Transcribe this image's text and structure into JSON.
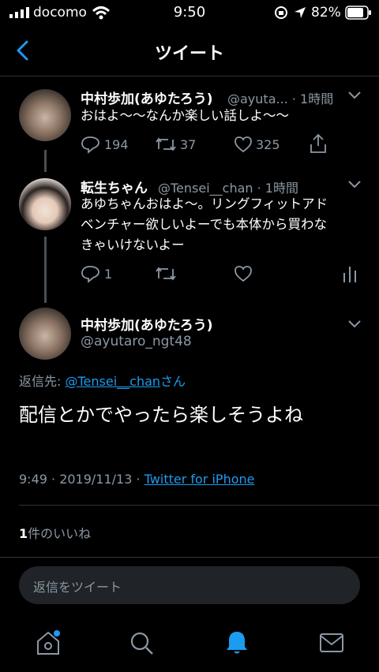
{
  "status": {
    "carrier": "docomo",
    "time": "9:50",
    "battery": "82%"
  },
  "nav": {
    "title": "ツイート"
  },
  "tweet1": {
    "name": "中村歩加(あゆたろう)",
    "handle_time": "@ayuta... · 1時間",
    "text": "おはよ〜〜なんか楽しい話しよ〜〜",
    "replies": "194",
    "retweets": "37",
    "likes": "325"
  },
  "tweet2": {
    "name": "転生ちゃん",
    "handle_time": "@Tensei__chan · 1時間",
    "text_lines": [
      "あゆちゃんおはよ〜。リングフィットアド",
      "ベンチャー欲しいよーでも本体から買わな",
      "きゃいけないよー"
    ],
    "replies": "1"
  },
  "main": {
    "name": "中村歩加(あゆたろう)",
    "handle": "@ayutaro_ngt48",
    "reply_prefix": "返信先: ",
    "reply_to": "@Tensei__chan",
    "reply_suffix": "さん",
    "text": "配信とかでやったら楽しそうよね",
    "time": "9:49 · 2019/11/13 · ",
    "source": "Twitter for iPhone",
    "likes_count": "1",
    "likes_label": "件のいいね"
  },
  "reply": {
    "placeholder": "返信をツイート"
  },
  "colors": {
    "accent": "#1d9bf0",
    "muted": "#8b98a5",
    "background": "#000000"
  }
}
